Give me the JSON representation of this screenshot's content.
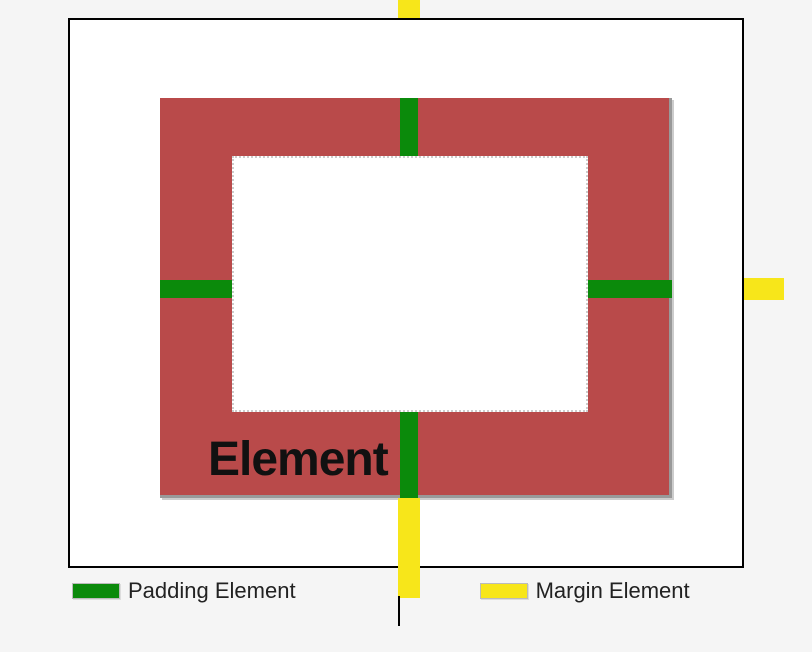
{
  "diagram": {
    "element_label": "Element",
    "indicators": {
      "padding": {
        "color": "#0b8a0b",
        "positions": [
          "top",
          "bottom",
          "left",
          "right"
        ]
      },
      "margin": {
        "color": "#f7e61a",
        "positions": [
          "top",
          "bottom",
          "left",
          "right"
        ]
      }
    }
  },
  "legend": {
    "padding_label": "Padding Element",
    "margin_label": "Margin Element",
    "padding_color": "#0b8a0b",
    "margin_color": "#f7e61a"
  }
}
